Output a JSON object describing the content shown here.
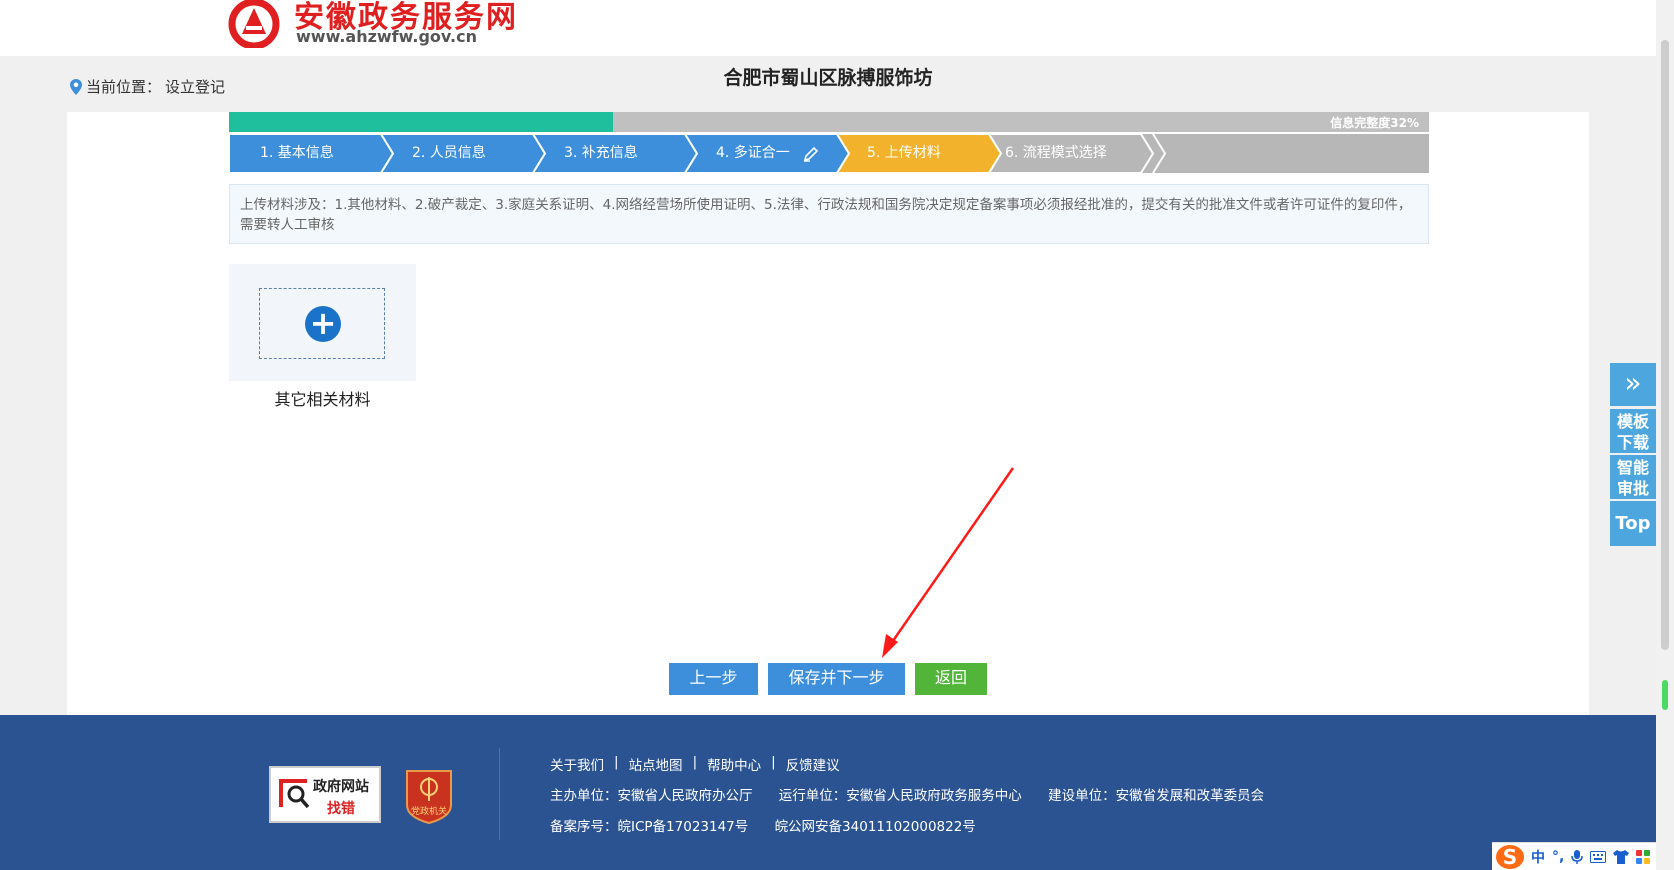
{
  "header": {
    "site_name": "安徽政务服务网",
    "site_url": "www.ahzwfw.gov.cn"
  },
  "location": {
    "label": "当前位置：",
    "value": "设立登记"
  },
  "company_name": "合肥市蜀山区脉搏服饰坊",
  "progress": {
    "text": "信息完整度32%",
    "fraction": 0.32
  },
  "steps": [
    {
      "label": "1. 基本信息",
      "state": "done"
    },
    {
      "label": "2. 人员信息",
      "state": "done"
    },
    {
      "label": "3. 补充信息",
      "state": "done"
    },
    {
      "label": "4. 多证合一",
      "state": "done"
    },
    {
      "label": "5. 上传材料",
      "state": "active"
    },
    {
      "label": "6. 流程模式选择",
      "state": "pending"
    }
  ],
  "notice": "上传材料涉及：1.其他材料、2.破产裁定、3.家庭关系证明、4.网络经营场所使用证明、5.法律、行政法规和国务院决定规定备案事项必须报经批准的，提交有关的批准文件或者许可证件的复印件，需要转人工审核",
  "upload": {
    "label": "其它相关材料",
    "plus": "+"
  },
  "buttons": {
    "prev": "上一步",
    "save_next": "保存并下一步",
    "back": "返回"
  },
  "side_tools": {
    "expand": "»",
    "template_1": "模板",
    "template_2": "下载",
    "audit_1": "智能",
    "audit_2": "审批",
    "top": "Top"
  },
  "footer": {
    "badge_gov_1": "政府网站",
    "badge_gov_2": "找错",
    "badge_party": "党政机关",
    "links": [
      "关于我们",
      "站点地图",
      "帮助中心",
      "反馈建议"
    ],
    "sponsor": "主办单位：安徽省人民政府办公厅",
    "operator": "运行单位：安徽省人民政府政务服务中心",
    "builder": "建设单位：安徽省发展和改革委员会",
    "icp": "备案序号：皖ICP备17023147号",
    "police": "皖公网安备34011102000822号"
  },
  "ime": {
    "logo": "S",
    "mode": "中",
    "punct": "°,"
  },
  "colors": {
    "done": "#3d8fdc",
    "active": "#f3b22c",
    "pending": "#b7b7b7",
    "progress": "#1fbf9d",
    "footer": "#2b5392",
    "accent_red": "#e02020"
  }
}
